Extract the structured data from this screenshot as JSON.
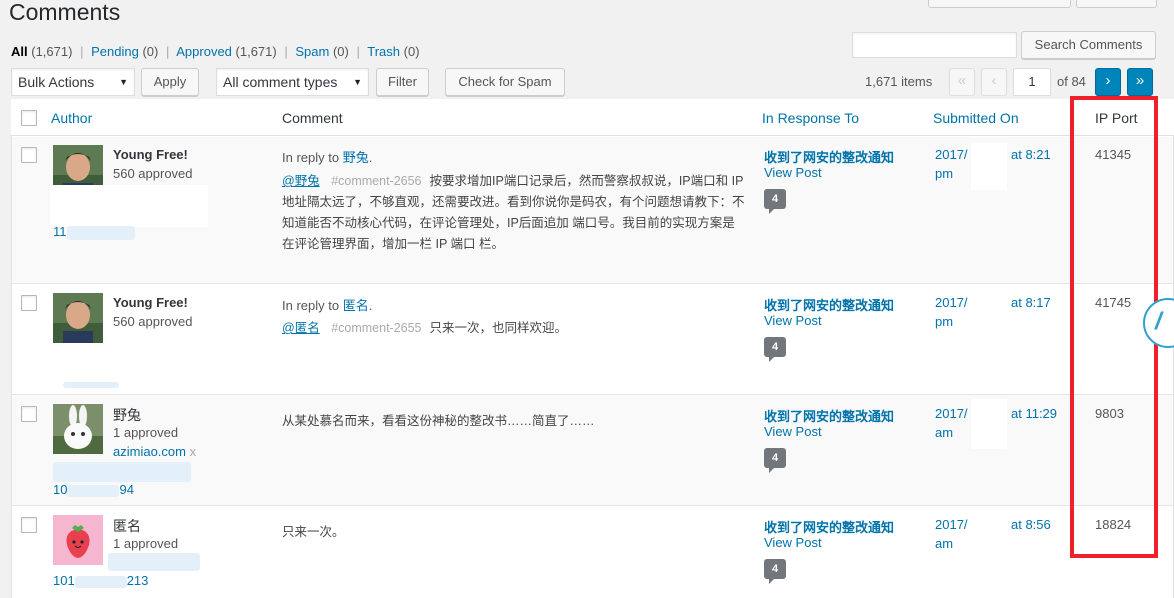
{
  "page": {
    "title": "Comments"
  },
  "filters": {
    "all_label": "All",
    "all_count": "(1,671)",
    "pending_label": "Pending",
    "pending_count": "(0)",
    "approved_label": "Approved",
    "approved_count": "(1,671)",
    "spam_label": "Spam",
    "spam_count": "(0)",
    "trash_label": "Trash",
    "trash_count": "(0)",
    "separator": "|"
  },
  "search": {
    "placeholder": "",
    "button_label": "Search Comments"
  },
  "toolbar": {
    "bulk_actions": "Bulk Actions",
    "apply_label": "Apply",
    "comment_types": "All comment types",
    "filter_label": "Filter",
    "check_spam_label": "Check for Spam",
    "caret": "▼"
  },
  "pagination": {
    "items": "1,671 items",
    "first": "«",
    "prev": "‹",
    "current_page": "1",
    "of_total": "of 84",
    "next": "›",
    "last": "»"
  },
  "columns": {
    "author": "Author",
    "comment": "Comment",
    "in_response_to": "In Response To",
    "submitted_on": "Submitted On",
    "ip_port": "IP Port"
  },
  "rows": [
    {
      "author": "Young Free!",
      "approved": "560 approved",
      "ip_fragment": "11",
      "in_reply_prefix": "In reply to ",
      "in_reply_name": "野兔",
      "in_reply_suffix": ".",
      "mention": "@野兔",
      "comment_ref": "#comment-2656",
      "comment_body": "按要求增加IP端口记录后，然而警察叔叔说，IP端口和 IP 地址隔太远了，不够直观，还需要改进。看到你说你是码农，有个问题想请教下：不知道能否不动核心代码，在评论管理处，IP后面追加 端口号。我目前的实现方案是在评论管理界面，增加一栏 IP 端口 栏。",
      "post_title": "收到了网安的整改通知",
      "view_post": "View Post",
      "comment_count": "4",
      "date_prefix": "2017/",
      "date_time": "at 8:21",
      "date_ampm": "pm",
      "port": "41345"
    },
    {
      "author": "Young Free!",
      "approved": "560 approved",
      "in_reply_prefix": "In reply to ",
      "in_reply_name": "匿名",
      "in_reply_suffix": ".",
      "mention": "@匿名",
      "comment_ref": "#comment-2655",
      "comment_body": "只来一次，也同样欢迎。",
      "post_title": "收到了网安的整改通知",
      "view_post": "View Post",
      "comment_count": "4",
      "date_prefix": "2017/",
      "date_time": "at 8:17",
      "date_ampm": "pm",
      "port": "41745"
    },
    {
      "author": "野兔",
      "approved": "1 approved",
      "url": "azimiao.com",
      "url_suffix": "x",
      "ip_fragment_a": "10",
      "ip_fragment_b": "94",
      "comment_body": "从某处慕名而来，看看这份神秘的整改书……简直了……",
      "post_title": "收到了网安的整改通知",
      "view_post": "View Post",
      "comment_count": "4",
      "date_prefix": "2017/",
      "date_time": "at 11:29",
      "date_ampm": "am",
      "port": "9803"
    },
    {
      "author": "匿名",
      "approved": "1 approved",
      "ip_fragment_a": "101",
      "ip_fragment_b": "213",
      "comment_body": "只来一次。",
      "post_title": "收到了网安的整改通知",
      "view_post": "View Post",
      "comment_count": "4",
      "date_prefix": "2017/",
      "date_time": "at 8:56",
      "date_ampm": "am",
      "port": "18824"
    }
  ],
  "colors": {
    "link": "#0073aa",
    "highlight": "#f0202a",
    "bubble": "#72777c"
  }
}
